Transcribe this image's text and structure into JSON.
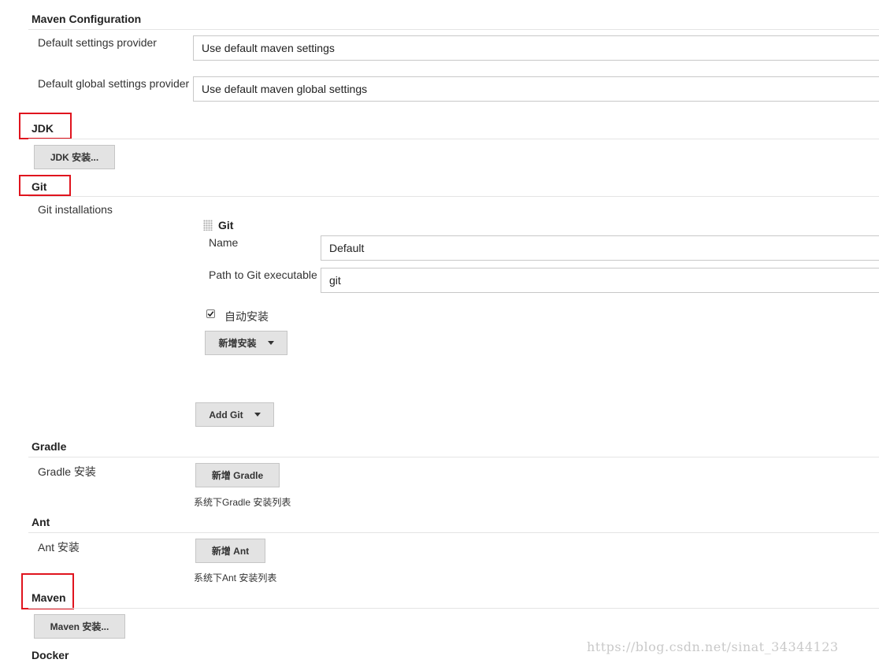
{
  "maven_config": {
    "title": "Maven Configuration",
    "default_settings_label": "Default settings provider",
    "default_settings_value": "Use default maven settings",
    "global_settings_label": "Default global settings provider",
    "global_settings_value": "Use default maven global settings"
  },
  "jdk": {
    "title": "JDK",
    "install_button": "JDK 安装..."
  },
  "git": {
    "title": "Git",
    "installations_label": "Git installations",
    "item_title": "Git",
    "name_label": "Name",
    "name_value": "Default",
    "path_label": "Path to Git executable",
    "path_value": "git",
    "auto_install_label": "自动安装",
    "auto_install_checked": true,
    "add_installer_button": "新增安装",
    "add_git_button": "Add Git"
  },
  "gradle": {
    "title": "Gradle",
    "install_label": "Gradle 安装",
    "add_button": "新增 Gradle",
    "help": "系统下Gradle 安装列表"
  },
  "ant": {
    "title": "Ant",
    "install_label": "Ant 安装",
    "add_button": "新增 Ant",
    "help": "系统下Ant 安装列表"
  },
  "maven": {
    "title": "Maven",
    "install_button": "Maven 安装..."
  },
  "docker": {
    "title": "Docker"
  },
  "watermark": "https://blog.csdn.net/sinat_34344123",
  "colors": {
    "highlight_box": "#e0141e",
    "button_bg": "#e3e3e3",
    "divider": "#e4e4e4"
  }
}
